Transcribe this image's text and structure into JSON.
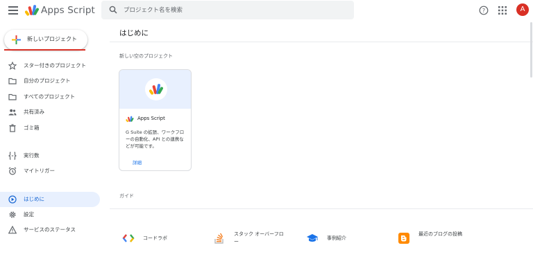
{
  "header": {
    "app_title": "Apps Script",
    "search_placeholder": "プロジェクト名を検索",
    "avatar_letter": "A",
    "icons": [
      "menu-icon",
      "apps-script-logo",
      "search-icon",
      "help-icon",
      "apps-grid-icon"
    ]
  },
  "sidebar": {
    "new_project_label": "新しいプロジェクト",
    "items": [
      {
        "label": "スター付きのプロジェクト",
        "icon": "star-icon"
      },
      {
        "label": "自分のプロジェクト",
        "icon": "folder-icon"
      },
      {
        "label": "すべてのプロジェクト",
        "icon": "folder-icon"
      },
      {
        "label": "共有済み",
        "icon": "people-icon"
      },
      {
        "label": "ゴミ箱",
        "icon": "trash-icon"
      },
      {
        "label": "実行数",
        "icon": "code-braces-icon"
      },
      {
        "label": "マイトリガー",
        "icon": "alarm-icon"
      },
      {
        "label": "はじめに",
        "icon": "play-circle-icon",
        "active": true
      },
      {
        "label": "設定",
        "icon": "gear-icon"
      },
      {
        "label": "サービスのステータス",
        "icon": "warning-icon"
      }
    ]
  },
  "main": {
    "title": "はじめに",
    "new_section_label": "新しい空のプロジェクト",
    "card": {
      "title": "Apps Script",
      "description": "G Suite の拡張、ワークフローの自動化、API との連携などが可能です。",
      "link": "詳細"
    },
    "guide_label": "ガイド",
    "guides": [
      {
        "label": "コードラボ",
        "icon": "codelab-icon"
      },
      {
        "label": "スタック オーバーフロー",
        "icon": "stack-overflow-icon"
      },
      {
        "label": "事例紹介",
        "icon": "graduation-cap-icon"
      },
      {
        "label": "最近のブログの投稿",
        "icon": "blogger-icon"
      }
    ]
  },
  "colors": {
    "accent_blue": "#1a73e8",
    "active_bg": "#e8f0fe",
    "avatar_red": "#d93025",
    "search_bg": "#f1f3f4"
  }
}
